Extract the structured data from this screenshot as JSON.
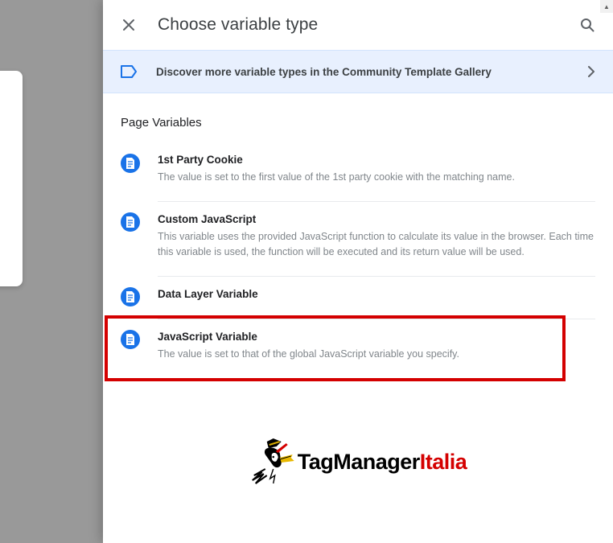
{
  "header": {
    "title": "Choose variable type"
  },
  "banner": {
    "text": "Discover more variable types in the Community Template Gallery"
  },
  "section": {
    "title": "Page Variables"
  },
  "variables": [
    {
      "title": "1st Party Cookie",
      "desc": "The value is set to the first value of the 1st party cookie with the matching name."
    },
    {
      "title": "Custom JavaScript",
      "desc": "This variable uses the provided JavaScript function to calculate its value in the browser. Each time this variable is used, the function will be executed and its return value will be used."
    },
    {
      "title": "Data Layer Variable",
      "desc": ""
    },
    {
      "title": "JavaScript Variable",
      "desc": "The value is set to that of the global JavaScript variable you specify."
    }
  ],
  "logo": {
    "part1": "TagManager",
    "part2": "Italia"
  },
  "highlighted_index": 3
}
